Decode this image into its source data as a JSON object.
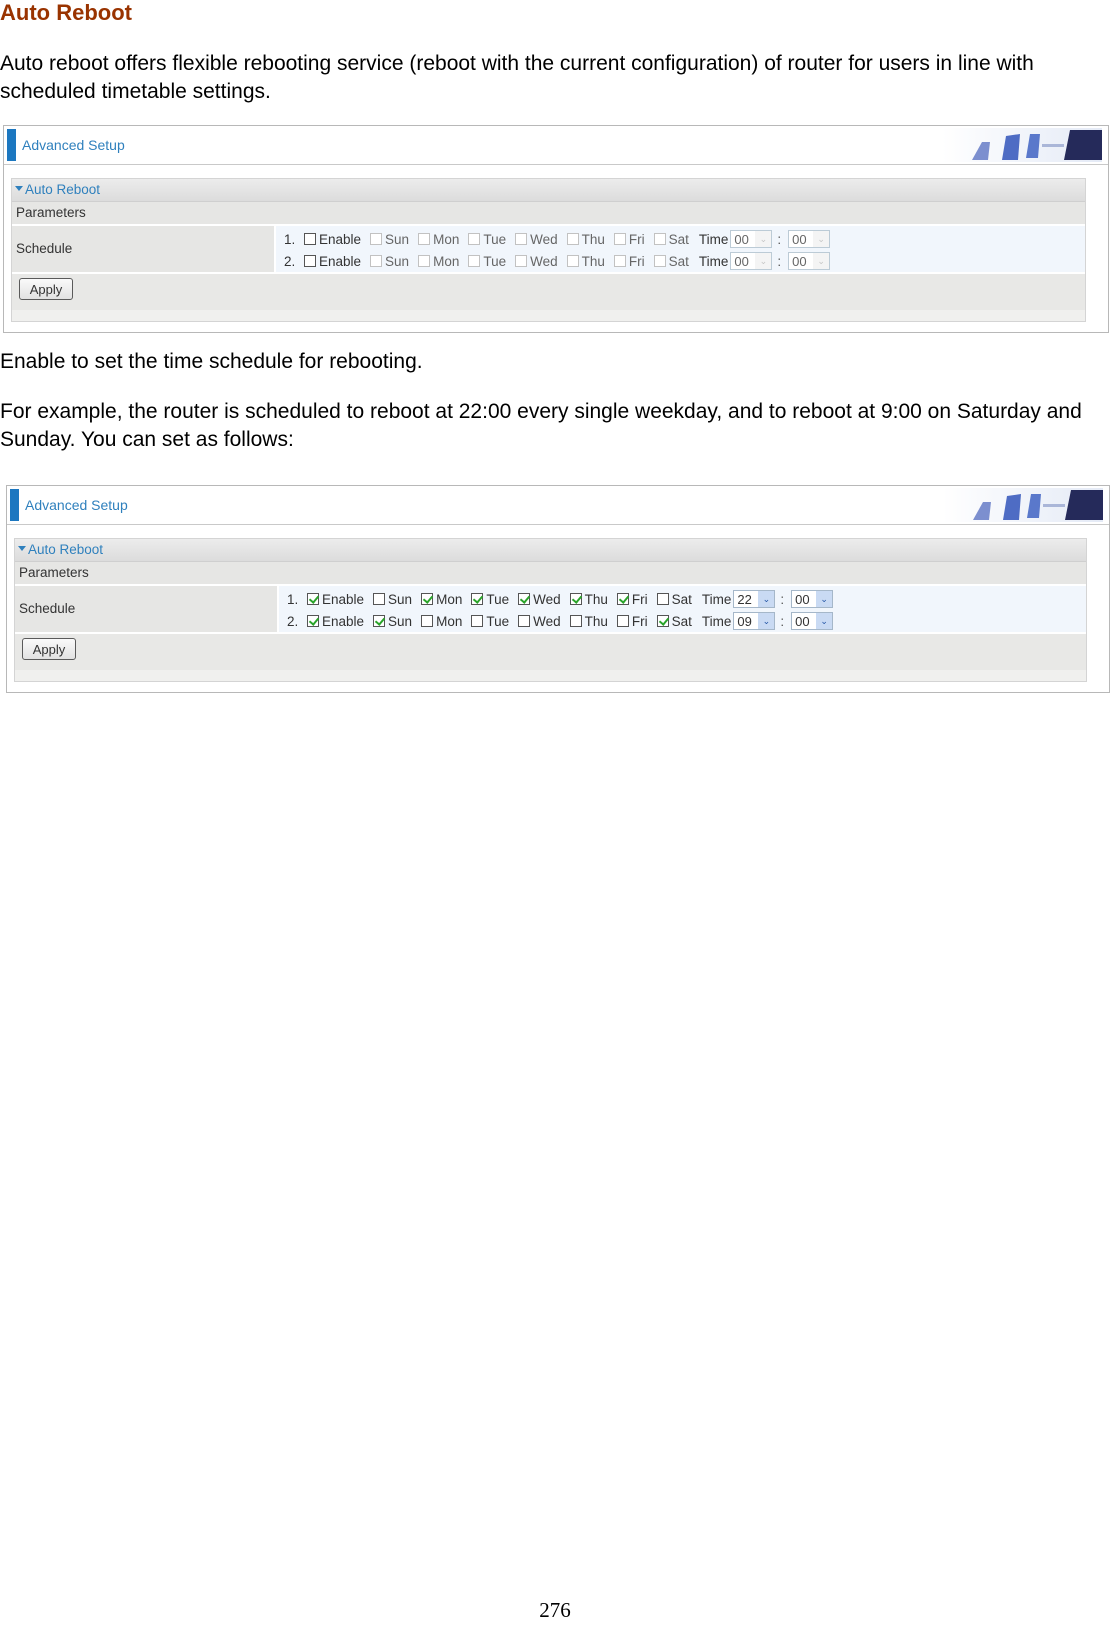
{
  "heading": "Auto Reboot",
  "paragraphs": {
    "intro": "Auto reboot offers flexible rebooting service (reboot with the current configuration) of router for users in line with scheduled timetable settings.",
    "enable_note": "Enable to set the time schedule for rebooting.",
    "example": "For example, the router is scheduled to reboot at 22:00 every single weekday, and to reboot at 9:00 on Saturday and Sunday. You can set as follows:"
  },
  "colors": {
    "heading": "#993300",
    "accent": "#1c77c0",
    "check": "#2aa42a"
  },
  "screenshots": [
    {
      "header": "Advanced Setup",
      "section": "Auto Reboot",
      "params_label": "Parameters",
      "schedule_label": "Schedule",
      "apply_label": "Apply",
      "time_label": "Time",
      "rows": [
        {
          "num": "1.",
          "enable_label": "Enable",
          "enabled": false,
          "days": [
            {
              "label": "Sun",
              "checked": false
            },
            {
              "label": "Mon",
              "checked": false
            },
            {
              "label": "Tue",
              "checked": false
            },
            {
              "label": "Wed",
              "checked": false
            },
            {
              "label": "Thu",
              "checked": false
            },
            {
              "label": "Fri",
              "checked": false
            },
            {
              "label": "Sat",
              "checked": false
            }
          ],
          "hour": "00",
          "minute": "00"
        },
        {
          "num": "2.",
          "enable_label": "Enable",
          "enabled": false,
          "days": [
            {
              "label": "Sun",
              "checked": false
            },
            {
              "label": "Mon",
              "checked": false
            },
            {
              "label": "Tue",
              "checked": false
            },
            {
              "label": "Wed",
              "checked": false
            },
            {
              "label": "Thu",
              "checked": false
            },
            {
              "label": "Fri",
              "checked": false
            },
            {
              "label": "Sat",
              "checked": false
            }
          ],
          "hour": "00",
          "minute": "00"
        }
      ]
    },
    {
      "header": "Advanced Setup",
      "section": "Auto Reboot",
      "params_label": "Parameters",
      "schedule_label": "Schedule",
      "apply_label": "Apply",
      "time_label": "Time",
      "rows": [
        {
          "num": "1.",
          "enable_label": "Enable",
          "enabled": true,
          "days": [
            {
              "label": "Sun",
              "checked": false
            },
            {
              "label": "Mon",
              "checked": true
            },
            {
              "label": "Tue",
              "checked": true
            },
            {
              "label": "Wed",
              "checked": true
            },
            {
              "label": "Thu",
              "checked": true
            },
            {
              "label": "Fri",
              "checked": true
            },
            {
              "label": "Sat",
              "checked": false
            }
          ],
          "hour": "22",
          "minute": "00"
        },
        {
          "num": "2.",
          "enable_label": "Enable",
          "enabled": true,
          "days": [
            {
              "label": "Sun",
              "checked": true
            },
            {
              "label": "Mon",
              "checked": false
            },
            {
              "label": "Tue",
              "checked": false
            },
            {
              "label": "Wed",
              "checked": false
            },
            {
              "label": "Thu",
              "checked": false
            },
            {
              "label": "Fri",
              "checked": false
            },
            {
              "label": "Sat",
              "checked": true
            }
          ],
          "hour": "09",
          "minute": "00"
        }
      ]
    }
  ],
  "page_number": "276"
}
